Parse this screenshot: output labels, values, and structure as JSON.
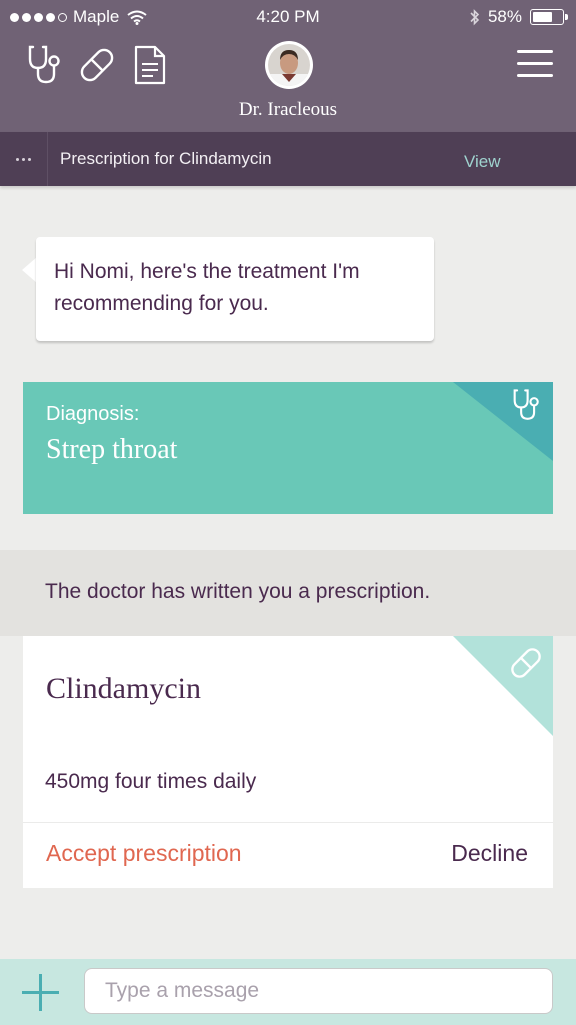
{
  "status_bar": {
    "carrier": "Maple",
    "time": "4:20 PM",
    "battery_percent": "58%",
    "battery_level": 0.58,
    "signal_bars_filled": 4,
    "signal_bars_total": 5
  },
  "header": {
    "icons": [
      "stethoscope-icon",
      "pill-icon",
      "document-icon"
    ],
    "doctor_name": "Dr. Iracleous",
    "menu_icon": "hamburger-menu-icon",
    "background_color": "#706275"
  },
  "subbar": {
    "more_icon": "ellipsis-icon",
    "title": "Prescription for Clindamycin",
    "action_label": "View",
    "background_color": "#4f3f55",
    "action_color": "#9fd3cf"
  },
  "message": {
    "text": "Hi Nomi, here's the treatment I'm recommending for you."
  },
  "diagnosis": {
    "label": "Diagnosis:",
    "value": "Strep throat",
    "icon": "stethoscope-icon",
    "color": "#69c8b7"
  },
  "prescription": {
    "banner": "The doctor has written you a prescription.",
    "drug_name": "Clindamycin",
    "dosage": "450mg four times daily",
    "icon": "pill-icon",
    "accept_label": "Accept prescription",
    "decline_label": "Decline",
    "accept_color": "#e06750"
  },
  "composer": {
    "add_icon": "plus-icon",
    "placeholder": "Type a message",
    "value": ""
  },
  "colors": {
    "text_primary": "#4a2a4e",
    "background": "#ededeb"
  }
}
